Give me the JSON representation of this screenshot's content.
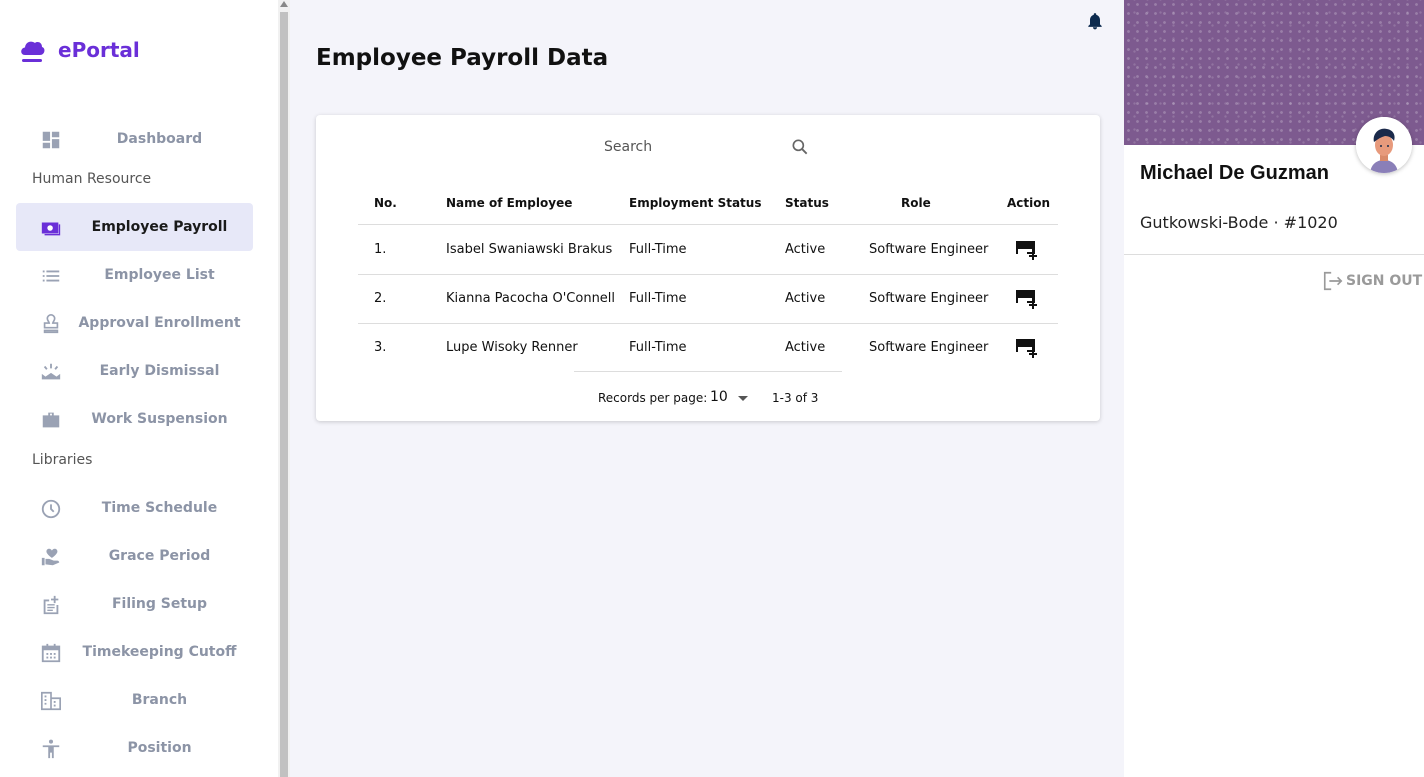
{
  "app": {
    "name": "ePortal"
  },
  "sidebar": {
    "sections": {
      "hr": "Human Resource",
      "libraries": "Libraries"
    },
    "items": [
      {
        "label": "Dashboard",
        "icon": "dashboard-icon"
      },
      {
        "label": "Employee Payroll",
        "icon": "payroll-icon",
        "active": true
      },
      {
        "label": "Employee List",
        "icon": "list-icon"
      },
      {
        "label": "Approval Enrollment",
        "icon": "stamp-icon"
      },
      {
        "label": "Early Dismissal",
        "icon": "sunset-icon"
      },
      {
        "label": "Work Suspension",
        "icon": "briefcase-icon"
      },
      {
        "label": "Time Schedule",
        "icon": "clock-icon"
      },
      {
        "label": "Grace Period",
        "icon": "hand-heart-icon"
      },
      {
        "label": "Filing Setup",
        "icon": "post-add-icon"
      },
      {
        "label": "Timekeeping Cutoff",
        "icon": "calendar-icon"
      },
      {
        "label": "Branch",
        "icon": "building-icon"
      },
      {
        "label": "Position",
        "icon": "person-icon"
      }
    ]
  },
  "main": {
    "title": "Employee Payroll Data",
    "search": {
      "placeholder": "Search"
    },
    "table": {
      "headers": [
        "No.",
        "Name of Employee",
        "Employment Status",
        "Status",
        "Role",
        "Action"
      ],
      "rows": [
        {
          "no": "1.",
          "name": "Isabel Swaniawski Brakus",
          "employment_status": "Full-Time",
          "status": "Active",
          "role": "Software Engineer"
        },
        {
          "no": "2.",
          "name": "Kianna Pacocha O'Connell",
          "employment_status": "Full-Time",
          "status": "Active",
          "role": "Software Engineer"
        },
        {
          "no": "3.",
          "name": "Lupe Wisoky Renner",
          "employment_status": "Full-Time",
          "status": "Active",
          "role": "Software Engineer"
        }
      ],
      "action_icon": "add-card-icon"
    },
    "pagination": {
      "label": "Records per page:",
      "per_page": "10",
      "range": "1-3 of 3"
    }
  },
  "user": {
    "name": "Michael De Guzman",
    "company": "Gutkowski-Bode · #1020",
    "signout": "SIGN OUT"
  },
  "colors": {
    "brand": "#6a2fd8",
    "banner": "#7d5a8f",
    "active_bg": "#e7e8f8",
    "nav_text": "#8c94a6",
    "bell": "#0d2b4f"
  }
}
